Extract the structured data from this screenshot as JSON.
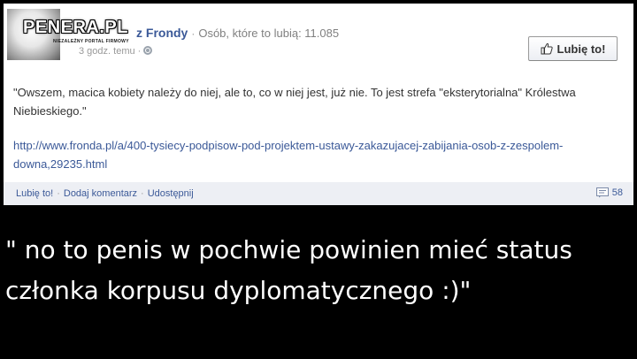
{
  "post": {
    "watermark": "PENERA.PL",
    "watermark_subtitle": "NIEZALEŻNY PORTAL FIRMOWY",
    "page_name": "z Frondy",
    "separator": "·",
    "likes_text": "Osób, które to lubią: 11.085",
    "timestamp": "3 godz. temu ·",
    "like_page_label": "Lubię to!",
    "quote": "\"Owszem, macica kobiety należy do niej, ale to, co w niej jest, już nie. To jest strefa \"eksterytorialna\" Królestwa Niebieskiego.\"",
    "link": "http://www.fronda.pl/a/400-tysiecy-podpisow-pod-projektem-ustawy-zakazujacej-zabijania-osob-z-zespolem-downa,29235.html",
    "actions": {
      "like": "Lubię to!",
      "comment": "Dodaj komentarz",
      "share": "Udostępnij",
      "dot": "·"
    },
    "comment_count": "58"
  },
  "caption": "\" no to penis w pochwie powinien mieć status członka korpusu dyplomatycznego :)\"",
  "colors": {
    "facebook_blue": "#3b5998",
    "footer_bg": "#edeff4",
    "background": "#000000",
    "caption_text": "#ffffff"
  },
  "icons": {
    "globe": "globe-icon",
    "thumb": "thumbs-up-icon",
    "comment": "comment-icon"
  }
}
